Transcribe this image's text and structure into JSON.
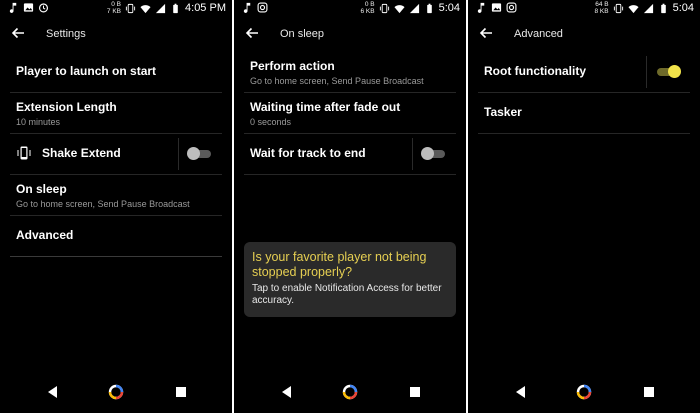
{
  "screens": [
    {
      "status": {
        "net_up": "0 B",
        "net_down": "7 KB",
        "time": "4:05",
        "time_suffix": "PM"
      },
      "title": "Settings",
      "items": [
        {
          "label": "Player to launch on start"
        },
        {
          "label": "Extension Length",
          "sub": "10 minutes"
        },
        {
          "label": "Shake Extend",
          "toggle": false
        },
        {
          "label": "On sleep",
          "sub": "Go to home screen, Send Pause Broadcast"
        },
        {
          "label": "Advanced"
        }
      ]
    },
    {
      "status": {
        "net_up": "0 B",
        "net_down": "6 KB",
        "time": "5:04"
      },
      "title": "On sleep",
      "items": [
        {
          "label": "Perform action",
          "sub": "Go to home screen, Send Pause Broadcast"
        },
        {
          "label": "Waiting time after fade out",
          "sub": "0 seconds"
        },
        {
          "label": "Wait for track to end",
          "toggle": false
        }
      ],
      "card": {
        "question": "Is your favorite player not being stopped properly?",
        "detail": "Tap to enable Notification Access for better accuracy."
      }
    },
    {
      "status": {
        "net_up": "64 B",
        "net_down": "8 KB",
        "time": "5:04"
      },
      "title": "Advanced",
      "items": [
        {
          "label": "Root functionality",
          "toggle": true
        },
        {
          "label": "Tasker"
        }
      ]
    }
  ],
  "colors": {
    "accent": "#f2e34a",
    "card_question": "#e6cf52",
    "background": "#000000"
  },
  "icons": [
    "music-note-icon",
    "image-icon",
    "alarm-icon",
    "instagram-icon",
    "vibrate-icon",
    "wifi-icon",
    "signal-icon",
    "battery-icon",
    "back-arrow-icon",
    "phone-shake-icon",
    "nav-back-icon",
    "nav-home-icon",
    "nav-recents-icon"
  ]
}
